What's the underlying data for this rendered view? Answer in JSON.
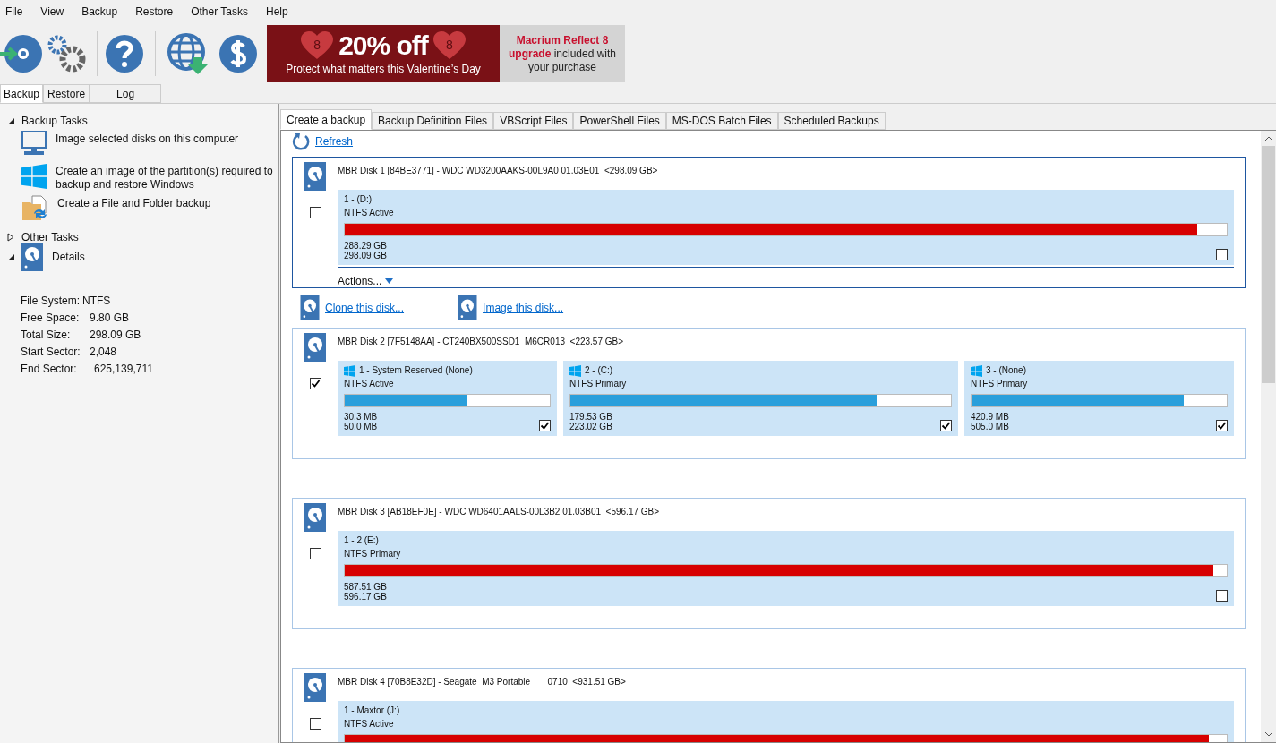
{
  "menu": [
    "File",
    "View",
    "Backup",
    "Restore",
    "Other Tasks",
    "Help"
  ],
  "banner": {
    "discount": "20% off",
    "tagline": "Protect what matters this Valentine’s Day",
    "badges": [
      "8",
      "8"
    ],
    "offer_lines": [
      [
        {
          "text": "Macrium Reflect 8",
          "highlight": true
        }
      ],
      [
        {
          "text": "upgrade",
          "highlight": true
        },
        {
          "text": " included with",
          "highlight": false
        }
      ],
      [
        {
          "text": "your purchase",
          "highlight": false
        }
      ]
    ]
  },
  "main_tabs": [
    {
      "label": "Backup",
      "selected": true
    },
    {
      "label": "Restore",
      "selected": false
    },
    {
      "label": "Log",
      "selected": false
    }
  ],
  "sidebar": {
    "sections": [
      {
        "title": "Backup Tasks",
        "expanded": true,
        "kind": "tasks",
        "items": [
          {
            "kind": "monitor",
            "label": "Image selected disks on this computer"
          },
          {
            "kind": "windows",
            "label": "Create an image of the partition(s) required to backup and restore Windows"
          },
          {
            "kind": "folder",
            "label": "Create a File and Folder backup"
          }
        ]
      },
      {
        "title": "Other Tasks",
        "expanded": false,
        "kind": "tasks"
      },
      {
        "title": "Details",
        "expanded": true,
        "kind": "details"
      }
    ],
    "details": [
      {
        "label": "File System:",
        "value": "NTFS"
      },
      {
        "label": "Free Space:",
        "value": "9.80 GB"
      },
      {
        "label": "Total Size:",
        "value": "298.09 GB"
      },
      {
        "label": "Start Sector:",
        "value": "2,048"
      },
      {
        "label": "End Sector:",
        "value": "625,139,711"
      }
    ]
  },
  "content_tabs": [
    {
      "label": "Create a backup",
      "selected": true
    },
    {
      "label": "Backup Definition Files",
      "selected": false
    },
    {
      "label": "VBScript Files",
      "selected": false
    },
    {
      "label": "PowerShell Files",
      "selected": false
    },
    {
      "label": "MS-DOS Batch Files",
      "selected": false
    },
    {
      "label": "Scheduled Backups",
      "selected": false
    }
  ],
  "refresh": "Refresh",
  "disks": [
    {
      "title": "MBR Disk 1 [84BE3771] - WDC WD3200AAKS-00L9A0 01.03E01  <298.09 GB>",
      "checked": false,
      "selected": true,
      "actions": "Actions...",
      "links": [
        "Clone this disk...",
        "Image this disk..."
      ],
      "partitions": [
        {
          "label": "1 -  (D:)",
          "windows": false,
          "fs": "NTFS Active",
          "level": 0.966,
          "color": "#d70000",
          "used": "288.29 GB",
          "total": "298.09 GB",
          "checked": false
        }
      ]
    },
    {
      "title": "MBR Disk 2 [7F5148AA] - CT240BX500SSD1  M6CR013  <223.57 GB>",
      "checked": true,
      "selected": false,
      "partitions": [
        {
          "label": "1 - System Reserved (None)",
          "windows": true,
          "fs": "NTFS Active",
          "level": 0.6,
          "color": "#2a9fdb",
          "used": "30.3 MB",
          "total": "50.0 MB",
          "checked": true
        },
        {
          "label": "2 -  (C:)",
          "windows": true,
          "fs": "NTFS Primary",
          "level": 0.805,
          "color": "#2a9fdb",
          "used": "179.53 GB",
          "total": "223.02 GB",
          "checked": true
        },
        {
          "label": "3 -  (None)",
          "windows": true,
          "fs": "NTFS Primary",
          "level": 0.833,
          "color": "#2a9fdb",
          "used": "420.9 MB",
          "total": "505.0 MB",
          "checked": true
        }
      ]
    },
    {
      "title": "MBR Disk 3 [AB18EF0E] - WDC WD6401AALS-00L3B2 01.03B01  <596.17 GB>",
      "checked": false,
      "selected": false,
      "partitions": [
        {
          "label": "1 - 2 (E:)",
          "windows": false,
          "fs": "NTFS Primary",
          "level": 0.985,
          "color": "#d70000",
          "used": "587.51 GB",
          "total": "596.17 GB",
          "checked": false
        }
      ]
    },
    {
      "title": "MBR Disk 4 [70B8E32D] - Seagate  M3 Portable       0710  <931.51 GB>",
      "checked": false,
      "selected": false,
      "partitions": [
        {
          "label": "1 - Maxtor (J:)",
          "windows": false,
          "fs": "NTFS Active",
          "level": 0.98,
          "color": "#d70000"
        }
      ]
    }
  ]
}
